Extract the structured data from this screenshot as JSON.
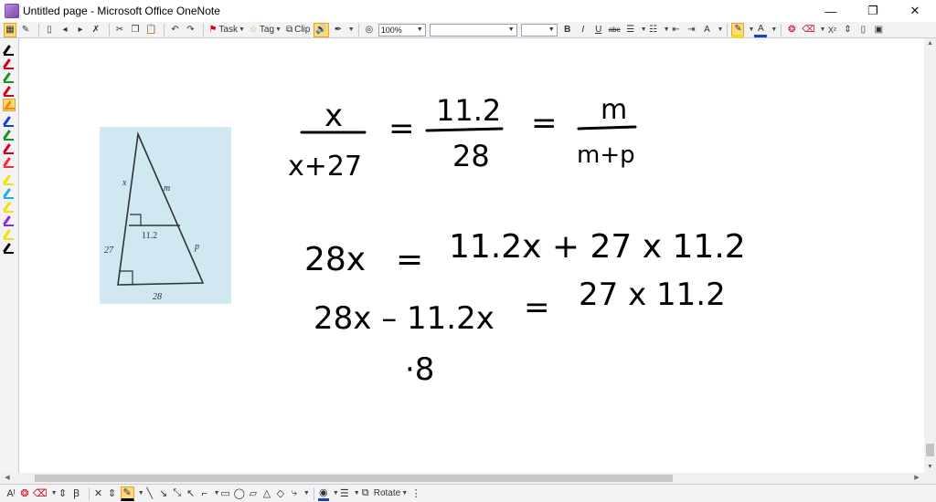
{
  "window": {
    "title": "Untitled page - Microsoft Office OneNote",
    "minimize": "—",
    "restore": "❐",
    "close": "✕"
  },
  "toolbar": {
    "task_label": "Task",
    "tag_label": "Tag",
    "clip_label": "Clip",
    "zoom_value": "100%",
    "font_value": "",
    "size_value": "",
    "bold": "B",
    "italic": "I",
    "underline": "U",
    "strike": "abc",
    "x2": "X²"
  },
  "pens": [
    {
      "color": "#000000"
    },
    {
      "color": "#d0021b"
    },
    {
      "color": "#1a8f2a"
    },
    {
      "color": "#d0021b"
    },
    {
      "color": "#f08a00"
    },
    {
      "color": "#1a3fd0"
    },
    {
      "color": "#1a8f2a"
    },
    {
      "color": "#d0021b"
    },
    {
      "color": "#ff2a2a"
    },
    {
      "color": "#f2e200"
    },
    {
      "color": "#19b0e8"
    },
    {
      "color": "#f2e200"
    },
    {
      "color": "#8a2be2"
    },
    {
      "color": "#f2e200"
    },
    {
      "color": "#000000"
    }
  ],
  "figure": {
    "label_x": "x",
    "label_m": "m",
    "label_mid": "11.2",
    "label_27": "27",
    "label_p": "p",
    "label_28": "28"
  },
  "ink": {
    "eq1_x": "x",
    "eq1_den": "x+27",
    "eq1_eq1": "=",
    "eq1_mid_num": "11.2",
    "eq1_mid_den": "28",
    "eq1_eq2": "=",
    "eq1_m": "m",
    "eq1_mp": "m+p",
    "eq2_left": "28x",
    "eq2_eq": "=",
    "eq2_right": "11.2x + 27 x 11.2",
    "eq3_left": "28x – 11.2x",
    "eq3_eq": "=",
    "eq3_right": "27 x 11.2",
    "eq4": "·8"
  },
  "drawbar": {
    "rotate_label": "Rotate"
  }
}
